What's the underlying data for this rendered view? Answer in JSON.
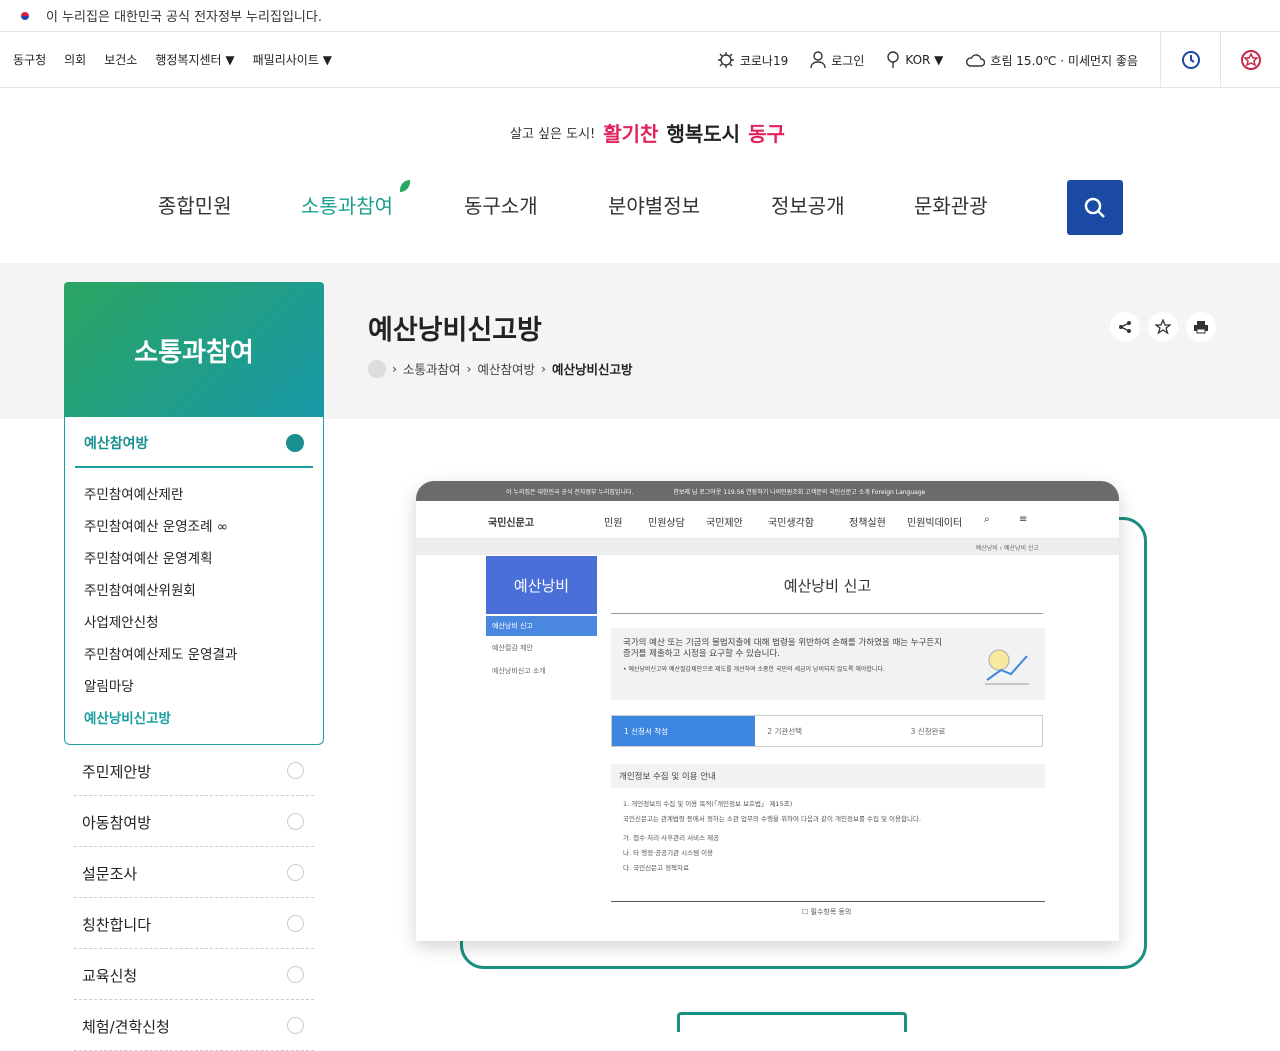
{
  "notice": "이 누리집은 대한민국 공식 전자정부 누리집입니다.",
  "utility": {
    "left": [
      "동구청",
      "의회",
      "보건소",
      "행정복지센터 ▼",
      "패밀리사이트 ▼"
    ],
    "corona": "코로나19",
    "login": "로그인",
    "lang": "KOR ▼",
    "weather": "흐림 15.0℃ · 미세먼지 좋음"
  },
  "logo": {
    "slogan": "살고 싶은 도시!",
    "name1": "활기찬",
    "name2": "행복도시",
    "name3": "동구"
  },
  "gnb": [
    "종합민원",
    "소통과참여",
    "동구소개",
    "분야별정보",
    "정보공개",
    "문화관광"
  ],
  "side": {
    "heading": "소통과참여",
    "open_title": "예산참여방",
    "sub_items": [
      "주민참여예산제란",
      "주민참여예산 운영조례 ∞",
      "주민참여예산 운영계획",
      "주민참여예산위원회",
      "사업제안신청",
      "주민참여예산제도 운영결과",
      "알림마당",
      "예산낭비신고방"
    ],
    "menus": [
      "주민제안방",
      "아동참여방",
      "설문조사",
      "칭찬합니다",
      "교육신청",
      "체험/견학신청"
    ]
  },
  "page": {
    "title": "예산낭비신고방",
    "breadcrumb": [
      "소통과참여",
      "예산참여방",
      "예산낭비신고방"
    ]
  },
  "mock": {
    "top_notice": "이 누리집은 대한민국 공식 전자정부 누리집입니다.",
    "top_links": "한보레 님   로그아웃   119.56 연장하기   나의민원조회   고객문의   국민신문고 소개   Foreign Language",
    "logo": "국민신문고",
    "nav": [
      "민원",
      "민원상담",
      "국민제안",
      "국민생각함",
      "정책실현",
      "민원빅데이터"
    ],
    "sub_bc": "예산낭비 › 예산낭비 신고",
    "side_head": "예산낭비",
    "side_items": [
      "예산낭비 신고",
      "예산절감 제안",
      "예산낭비신고 소개"
    ],
    "title": "예산낭비 신고",
    "info": "국가의 예산 또는 기금의 불법지출에 대해 법령을 위반하여 손해를 가하였을 때는 누구든지 증거를 제출하고 시정을 요구할 수 있습니다.",
    "info_note": "• 예산낭비신고와 예산절감제안으로 제도를 개선하여 소중한 국민의 세금이 낭비되지 않도록 해야합니다.",
    "steps": [
      "1 신청서 작성",
      "2 기관선택",
      "3 신청완료"
    ],
    "priv_heading": "개인정보 수집 및 이용 안내",
    "priv_text": [
      "1. 개인정보의 수집 및 이용 목적(「개인정보 보호법」 제15조)",
      "국민신문고는 관계법령 등에서 정하는 소관 업무의 수행을 위하여 다음과 같이 개인정보를 수집 및 이용합니다.",
      "가. 접수·처리·사후관리 서비스 제공",
      "나. 타 행정·공공기관 시스템 이용",
      "다. 국민신문고 정책자료"
    ],
    "agree": "☐ 필수항목 동의"
  }
}
